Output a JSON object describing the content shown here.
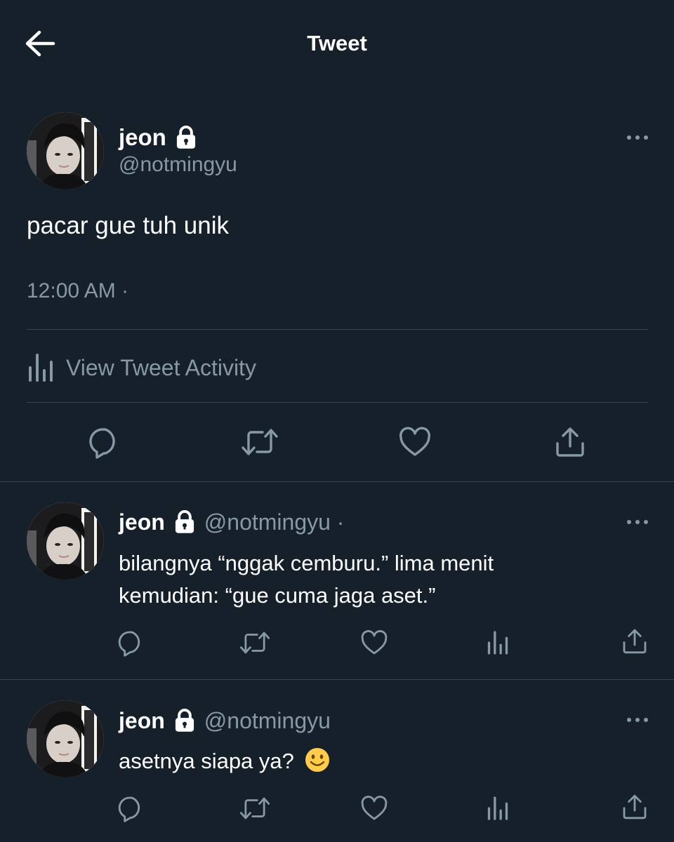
{
  "header": {
    "title": "Tweet",
    "back_icon": "arrow-left-icon"
  },
  "main_tweet": {
    "name": "jeon",
    "handle": "@notmingyu",
    "text": "pacar gue tuh unik",
    "time": "12:00 AM ·",
    "activity_label": "View Tweet Activity"
  },
  "replies": [
    {
      "name": "jeon",
      "handle": "@notmingyu ·",
      "text_line1": "bilangnya “nggak cemburu.” lima menit",
      "text_line2": "kemudian: “gue cuma jaga aset.”"
    },
    {
      "name": "jeon",
      "handle": "@notmingyu",
      "text": "asetnya siapa ya?"
    }
  ],
  "colors": {
    "background": "#15202b",
    "text": "#ffffff",
    "secondary": "#8899a6",
    "divider": "#38444d"
  }
}
